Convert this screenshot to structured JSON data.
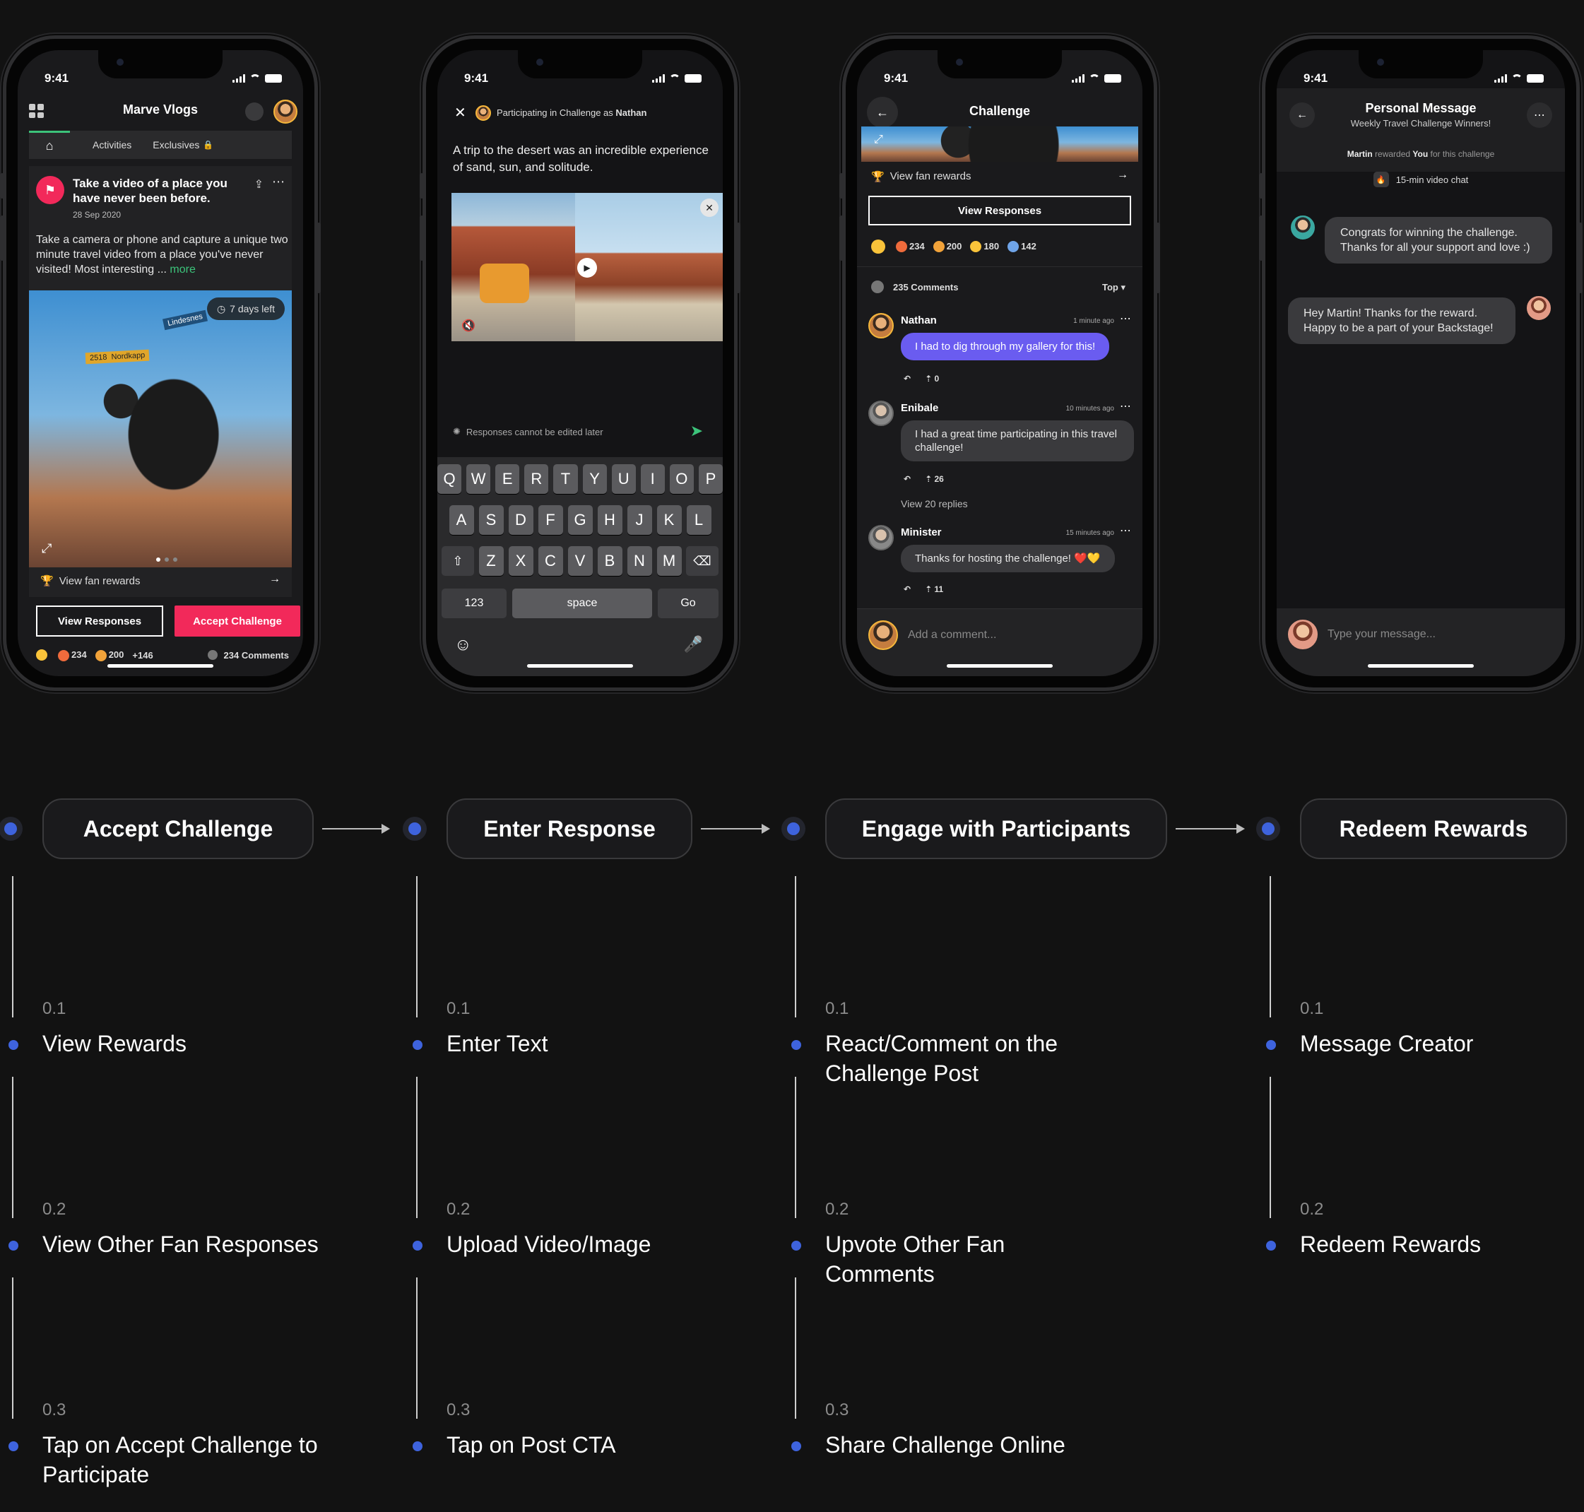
{
  "status_time": "9:41",
  "phone1": {
    "title": "Marve Vlogs",
    "tabs": [
      "Activities",
      "Exclusives"
    ],
    "challenge_title": "Take a video of a place you have never been before.",
    "date": "28 Sep 2020",
    "body": "Take a camera or phone and capture a unique two minute travel video from a place you've never visited! Most interesting ...",
    "more": "more",
    "days_left": "7 days left",
    "sign1": "Lindesnes",
    "sign2": "2518",
    "sign3": "Nordkapp",
    "rewards": "View fan rewards",
    "btn_view": "View Responses",
    "btn_accept": "Accept Challenge",
    "r1": "234",
    "r2": "200",
    "r3": "+146",
    "comments": "234 Comments"
  },
  "phone2": {
    "participating": "Participating in Challenge as",
    "name": "Nathan",
    "text": "A trip to the desert was an incredible experience of sand, sun, and solitude.",
    "note": "Responses cannot be edited later",
    "row1": [
      "Q",
      "W",
      "E",
      "R",
      "T",
      "Y",
      "U",
      "I",
      "O",
      "P"
    ],
    "row2": [
      "A",
      "S",
      "D",
      "F",
      "G",
      "H",
      "J",
      "K",
      "L"
    ],
    "row3": [
      "Z",
      "X",
      "C",
      "V",
      "B",
      "N",
      "M"
    ],
    "k123": "123",
    "kspace": "space",
    "kgo": "Go"
  },
  "phone3": {
    "title": "Challenge",
    "rewards": "View fan rewards",
    "btn_view": "View Responses",
    "r1": "234",
    "r2": "200",
    "r3": "180",
    "r4": "142",
    "comments": "235 Comments",
    "sort": "Top",
    "c1_name": "Nathan",
    "c1_time": "1 minute ago",
    "c1_text": "I had to dig through my gallery for this!",
    "c1_up": "0",
    "c2_name": "Enibale",
    "c2_time": "10 minutes ago",
    "c2_text": "I had a great time participating in this travel challenge!",
    "c2_up": "26",
    "c2_replies": "View 20 replies",
    "c3_name": "Minister",
    "c3_time": "15 minutes ago",
    "c3_text": "Thanks for hosting the challenge! ❤️💛",
    "c3_up": "11",
    "add_comment": "Add a comment..."
  },
  "phone4": {
    "title": "Personal Message",
    "subtitle": "Weekly Travel Challenge Winners!",
    "reward_from": "Martin",
    "reward_mid": "rewarded",
    "reward_you": "You",
    "reward_end": "for this challenge",
    "reward_item": "15-min video chat",
    "msg1": "Congrats for winning the challenge. Thanks for all your support and love :)",
    "msg2": "Hey Martin! Thanks for the reward. Happy to be a part of your Backstage!",
    "placeholder": "Type your message..."
  },
  "flow": {
    "stages": [
      "Accept Challenge",
      "Enter Response",
      "Engage with Participants",
      "Redeem Rewards"
    ],
    "col1": [
      {
        "n": "0.1",
        "t": "View Rewards"
      },
      {
        "n": "0.2",
        "t": "View Other Fan Responses"
      },
      {
        "n": "0.3",
        "t": "Tap on Accept Challenge to Participate"
      }
    ],
    "col2": [
      {
        "n": "0.1",
        "t": "Enter Text"
      },
      {
        "n": "0.2",
        "t": "Upload Video/Image"
      },
      {
        "n": "0.3",
        "t": "Tap on Post CTA"
      }
    ],
    "col3": [
      {
        "n": "0.1",
        "t": "React/Comment on the Challenge Post"
      },
      {
        "n": "0.2",
        "t": "Upvote Other Fan Comments"
      },
      {
        "n": "0.3",
        "t": "Share Challenge Online"
      }
    ],
    "col4": [
      {
        "n": "0.1",
        "t": "Message Creator"
      },
      {
        "n": "0.2",
        "t": "Redeem Rewards"
      }
    ]
  },
  "colors": {
    "accent_red": "#f2295a",
    "accent_blue": "#3e63dd",
    "bubble_purple": "#6a5cf0",
    "link_green": "#3cc37a"
  }
}
